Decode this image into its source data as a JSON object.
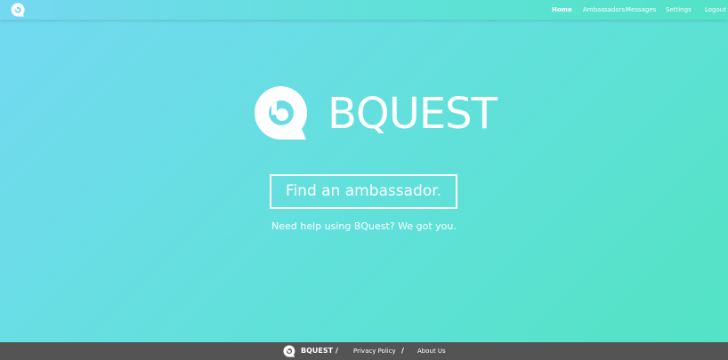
{
  "nav": {
    "logo_icon": "bquest-logo-icon",
    "items": [
      {
        "label": "Home",
        "active": true
      },
      {
        "label": "Ambassadors",
        "active": false
      },
      {
        "label": "Messages",
        "active": false
      },
      {
        "label": "Settings",
        "active": false
      },
      {
        "label": "Logout",
        "active": false
      }
    ]
  },
  "hero": {
    "logo_icon": "bquest-logo-icon",
    "title": "BQUEST",
    "cta_label": "Find an ambassador.",
    "tagline": "Need help using BQuest? We got you."
  },
  "footer": {
    "logo_icon": "bquest-logo-icon",
    "brand": "BQUEST",
    "separator": "/",
    "links": [
      "Privacy Policy",
      "About Us"
    ]
  },
  "colors": {
    "gradient_start": "#74d9f2",
    "gradient_end": "#52e3c3",
    "footer_bg": "#545454",
    "text": "#ffffff"
  }
}
